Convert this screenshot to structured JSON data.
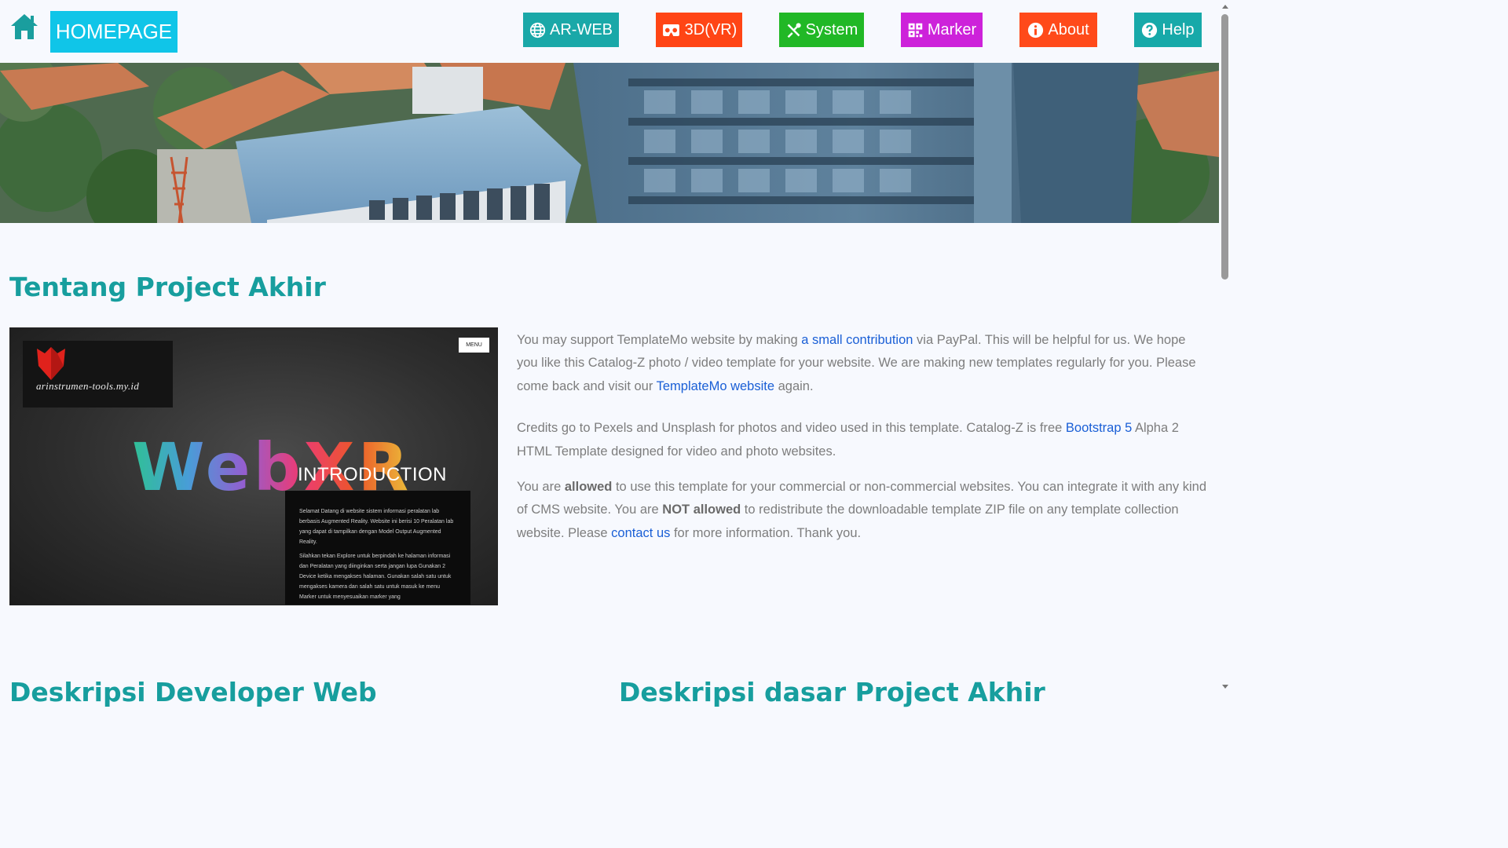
{
  "navbar": {
    "home_icon": "home-icon",
    "brand": "HOMEPAGE",
    "buttons": [
      {
        "label": "AR-WEB",
        "icon": "globe-icon",
        "color": "#1aa8a8"
      },
      {
        "label": "3D(VR)",
        "icon": "vr-headset-icon",
        "color": "#ff4515"
      },
      {
        "label": "System",
        "icon": "tools-icon",
        "color": "#21b826"
      },
      {
        "label": "Marker",
        "icon": "qr-code-icon",
        "color": "#cd22da"
      },
      {
        "label": "About",
        "icon": "info-icon",
        "color": "#ff4a1a"
      },
      {
        "label": "Help",
        "icon": "question-icon",
        "color": "#17a9a9"
      }
    ]
  },
  "section": {
    "title": "Tentang Project Akhir"
  },
  "preview": {
    "logo_text": "arinstrumen-tools.my.id",
    "menu_label": "MENU",
    "headline": "WebXR",
    "intro_title": "INTRODUCTION",
    "intro_paragraphs": [
      "Selamat Datang di website sistem informasi peralatan lab berbasis Augmented Reality. Website ini berisi 10 Peralatan lab yang dapat di tampilkan dengan Model Output Augmented Reality.",
      "Silahkan tekan Explore untuk berpindah ke halaman informasi dan Peralatan yang diinginkan serta jangan lupa Gunakan 2 Device ketika mengakses halaman. Gunakan salah satu untuk mengakses kamera dan salah satu untuk masuk ke menu Marker untuk menyesuaikan marker yang"
    ]
  },
  "paragraph1": {
    "t1": "You may support TemplateMo website by making ",
    "link1": "a small contribution",
    "t2": " via PayPal. This will be helpful for us. We hope you like this Catalog-Z photo / video template for your website. We are making new templates regularly for you. Please come back and visit our ",
    "link2": "TemplateMo website",
    "t3": " again."
  },
  "paragraph2": {
    "t1": "Credits go to Pexels and Unsplash for photos and video used in this template. Catalog-Z is free ",
    "link1": "Bootstrap 5",
    "t2": " Alpha 2 HTML Template designed for video and photo websites."
  },
  "paragraph3": {
    "t1": "You are ",
    "b1": "allowed",
    "t2": " to use this template for your commercial or non-commercial websites. You can integrate it with any kind of CMS website. You are ",
    "b2": "NOT allowed",
    "t3": " to redistribute the downloadable template ZIP file on any template collection website. Please ",
    "link1": "contact us",
    "t4": " for more information. Thank you."
  },
  "bottom": {
    "left_title": "Deskripsi Developer Web",
    "right_title": "Deskripsi dasar Project Akhir"
  },
  "colors": {
    "accent": "#179e9e",
    "brand_bg": "#10c5e8",
    "link": "#1a5fd6"
  }
}
